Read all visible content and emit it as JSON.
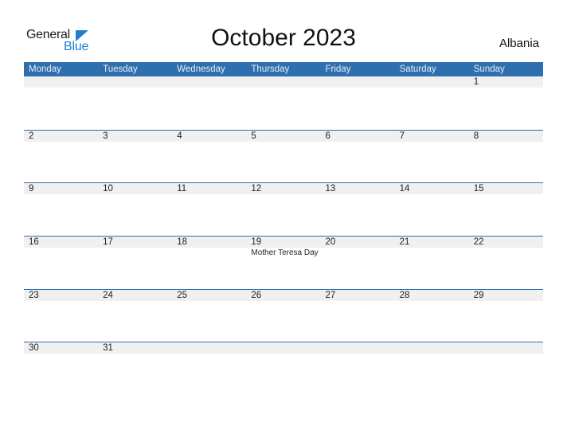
{
  "brand": {
    "line1": "General",
    "line2": "Blue",
    "accent": "#1e7fd0"
  },
  "title": "October 2023",
  "country": "Albania",
  "colors": {
    "header_bg": "#2e6fb0",
    "row_bg": "#f0f0f0"
  },
  "weekdays": [
    "Monday",
    "Tuesday",
    "Wednesday",
    "Thursday",
    "Friday",
    "Saturday",
    "Sunday"
  ],
  "weeks": [
    {
      "days": [
        "",
        "",
        "",
        "",
        "",
        "",
        "1"
      ],
      "events": [
        "",
        "",
        "",
        "",
        "",
        "",
        ""
      ]
    },
    {
      "days": [
        "2",
        "3",
        "4",
        "5",
        "6",
        "7",
        "8"
      ],
      "events": [
        "",
        "",
        "",
        "",
        "",
        "",
        ""
      ]
    },
    {
      "days": [
        "9",
        "10",
        "11",
        "12",
        "13",
        "14",
        "15"
      ],
      "events": [
        "",
        "",
        "",
        "",
        "",
        "",
        ""
      ]
    },
    {
      "days": [
        "16",
        "17",
        "18",
        "19",
        "20",
        "21",
        "22"
      ],
      "events": [
        "",
        "",
        "",
        "Mother Teresa Day",
        "",
        "",
        ""
      ]
    },
    {
      "days": [
        "23",
        "24",
        "25",
        "26",
        "27",
        "28",
        "29"
      ],
      "events": [
        "",
        "",
        "",
        "",
        "",
        "",
        ""
      ]
    },
    {
      "days": [
        "30",
        "31",
        "",
        "",
        "",
        "",
        ""
      ],
      "events": [
        "",
        "",
        "",
        "",
        "",
        "",
        ""
      ]
    }
  ]
}
